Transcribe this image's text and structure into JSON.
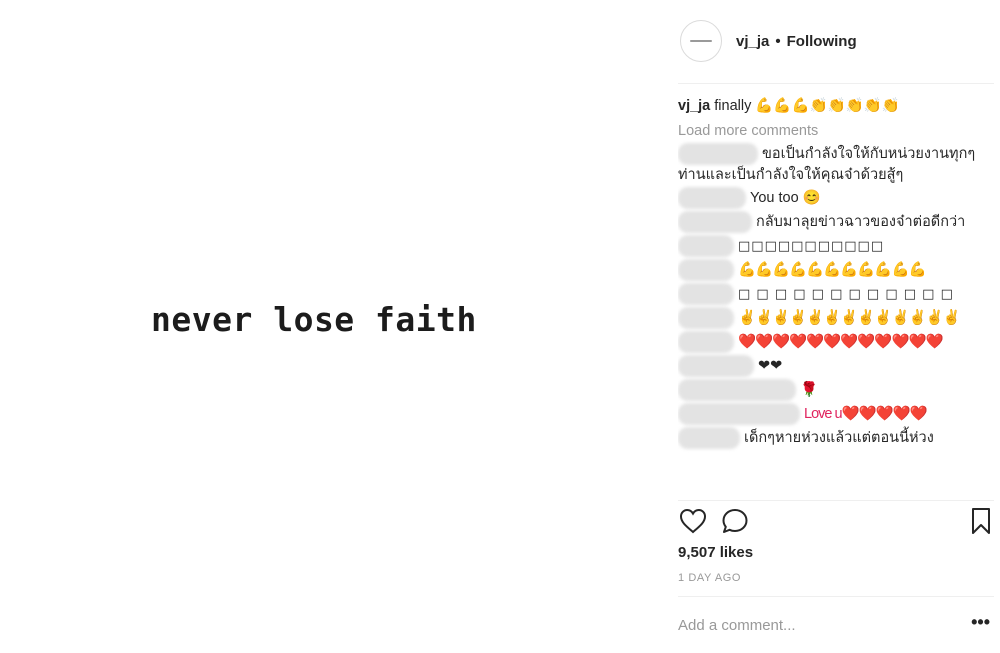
{
  "image": {
    "caption": "never lose faith"
  },
  "header": {
    "username": "vj_ja",
    "dot": "•",
    "follow_status": "Following"
  },
  "caption": {
    "username": "vj_ja",
    "text": "finally 💪💪💪👏👏👏👏👏"
  },
  "comments": {
    "load_more": "Load more comments",
    "items": [
      {
        "text": "ขอเป็นกำลังใจให้กับหน่วยงานทุกๆท่านและเป็นกำลังใจให้คุณจ๋าด้วยสู้ๆ"
      },
      {
        "text": "You too 😊"
      },
      {
        "text": "กลับมาลุยข่าวฉาวของจ๋าต่อดีกว่า"
      },
      {
        "text": "□□□□□□□□□□□"
      },
      {
        "text": "💪💪💪💪💪💪💪💪💪💪💪"
      },
      {
        "text": "□ □ □ □ □ □ □ □ □ □ □ □"
      },
      {
        "text": "✌✌✌✌✌✌✌✌✌✌✌✌✌"
      },
      {
        "text": "❤️❤️❤️❤️❤️❤️❤️❤️❤️❤️❤️❤️"
      },
      {
        "text": "❤❤"
      },
      {
        "text": "🌹"
      },
      {
        "text": "Love u❤️❤️❤️❤️❤️"
      },
      {
        "text": "เด็กๆหายห่วงแล้วแต่ตอนนี้ห่วง"
      }
    ]
  },
  "likes": "9,507 likes",
  "timestamp": "1 DAY AGO",
  "add_comment": {
    "placeholder": "Add a comment..."
  },
  "more_options": "•••",
  "icons": {
    "like": "heart-icon",
    "comment": "comment-icon",
    "save": "bookmark-icon"
  }
}
